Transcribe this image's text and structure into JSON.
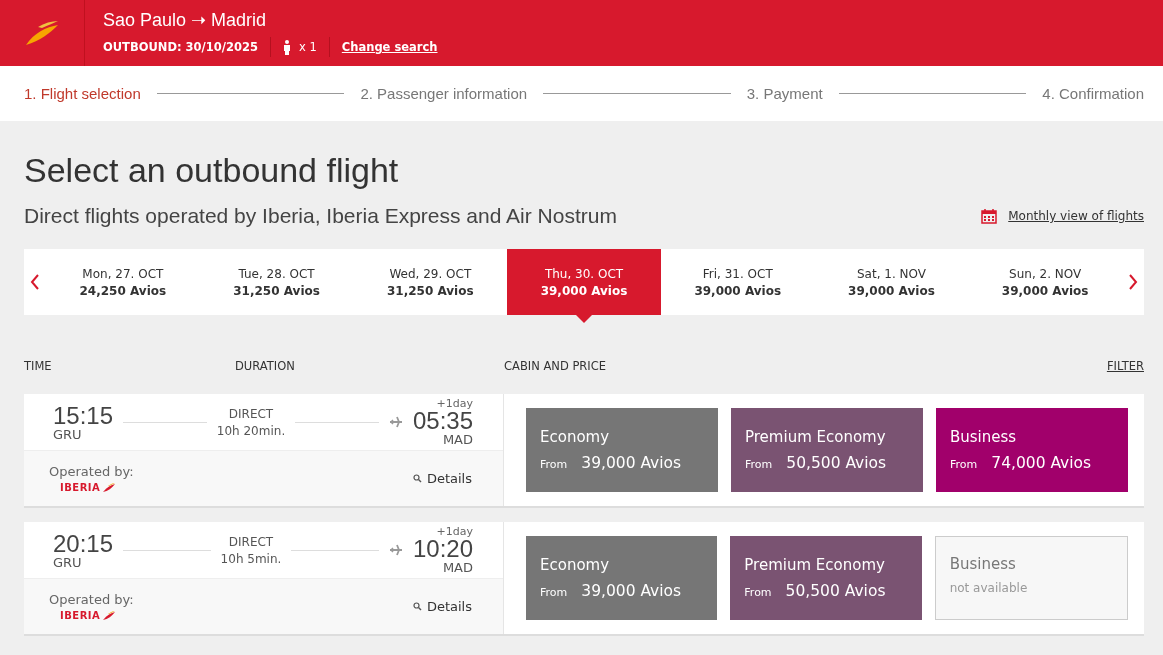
{
  "header": {
    "route_from": "Sao Paulo",
    "route_arrow": "➝",
    "route_to": "Madrid",
    "outbound": "OUTBOUND: 30/10/2025",
    "passengers": "x 1",
    "change_search": "Change search"
  },
  "steps": [
    {
      "label": "1. Flight selection",
      "selected": true
    },
    {
      "label": "2. Passenger information",
      "selected": false
    },
    {
      "label": "3. Payment",
      "selected": false
    },
    {
      "label": "4. Confirmation",
      "selected": false
    }
  ],
  "title": "Select an outbound flight",
  "subtitle": "Direct flights operated by Iberia, Iberia Express and Air Nostrum",
  "monthly_view": "Monthly view of flights",
  "dates": [
    {
      "day": "Mon, 27. OCT",
      "price": "24,250 Avios",
      "selected": false
    },
    {
      "day": "Tue, 28. OCT",
      "price": "31,250 Avios",
      "selected": false
    },
    {
      "day": "Wed, 29. OCT",
      "price": "31,250 Avios",
      "selected": false
    },
    {
      "day": "Thu, 30. OCT",
      "price": "39,000 Avios",
      "selected": true
    },
    {
      "day": "Fri, 31. OCT",
      "price": "39,000 Avios",
      "selected": false
    },
    {
      "day": "Sat, 1. NOV",
      "price": "39,000 Avios",
      "selected": false
    },
    {
      "day": "Sun, 2. NOV",
      "price": "39,000 Avios",
      "selected": false
    }
  ],
  "columns": {
    "time": "TIME",
    "duration": "DURATION",
    "cabin": "CABIN AND PRICE",
    "filter": "FILTER"
  },
  "flights": [
    {
      "depart": "15:15",
      "from": "GRU",
      "stops": "DIRECT",
      "duration": "10h 20min.",
      "day_offset": "+1day",
      "arrive": "05:35",
      "to": "MAD",
      "operated_by": "Operated by:",
      "airline": "IBERIA",
      "details": "Details",
      "cabins": [
        {
          "name": "Economy",
          "available": true,
          "from": "From",
          "price": "39,000 Avios",
          "color": "#767676"
        },
        {
          "name": "Premium Economy",
          "available": true,
          "from": "From",
          "price": "50,500 Avios",
          "color": "#7a5372"
        },
        {
          "name": "Business",
          "available": true,
          "from": "From",
          "price": "74,000 Avios",
          "color": "#a1006b"
        }
      ]
    },
    {
      "depart": "20:15",
      "from": "GRU",
      "stops": "DIRECT",
      "duration": "10h 5min.",
      "day_offset": "+1day",
      "arrive": "10:20",
      "to": "MAD",
      "operated_by": "Operated by:",
      "airline": "IBERIA",
      "details": "Details",
      "cabins": [
        {
          "name": "Economy",
          "available": true,
          "from": "From",
          "price": "39,000 Avios",
          "color": "#767676"
        },
        {
          "name": "Premium Economy",
          "available": true,
          "from": "From",
          "price": "50,500 Avios",
          "color": "#7a5372"
        },
        {
          "name": "Business",
          "available": false,
          "note": "not available",
          "color": "#f7f7f7"
        }
      ]
    }
  ]
}
